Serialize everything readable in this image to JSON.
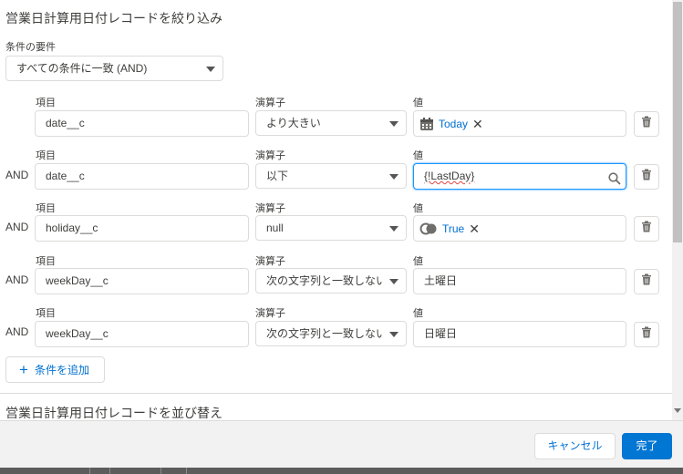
{
  "filter": {
    "title": "営業日計算用日付レコードを絞り込み",
    "condition_label": "条件の要件",
    "condition_value": "すべての条件に一致 (AND)",
    "field_label": "項目",
    "operator_label": "演算子",
    "value_label": "値",
    "and_label": "AND",
    "rows": [
      {
        "field": "date__c",
        "operator": "より大きい",
        "value": "Today",
        "value_type": "date-pill"
      },
      {
        "field": "date__c",
        "operator": "以下",
        "value": "{!LastDay}",
        "value_type": "search"
      },
      {
        "field": "holiday__c",
        "operator": "null",
        "value": "True",
        "value_type": "bool-pill"
      },
      {
        "field": "weekDay__c",
        "operator": "次の文字列と一致しない",
        "value": "土曜日",
        "value_type": "text"
      },
      {
        "field": "weekDay__c",
        "operator": "次の文字列と一致しない",
        "value": "日曜日",
        "value_type": "text"
      }
    ],
    "add_condition_label": "条件を追加"
  },
  "sort": {
    "title": "営業日計算用日付レコードを並び替え"
  },
  "footer": {
    "cancel_label": "キャンセル",
    "done_label": "完了"
  },
  "colors": {
    "accent": "#0176d3",
    "link": "#0070d2",
    "border": "#dddbda"
  },
  "icons": [
    "calendar-icon",
    "toggle-icon",
    "search-icon",
    "trash-icon",
    "close-icon",
    "chevron-down-icon",
    "add-icon"
  ]
}
